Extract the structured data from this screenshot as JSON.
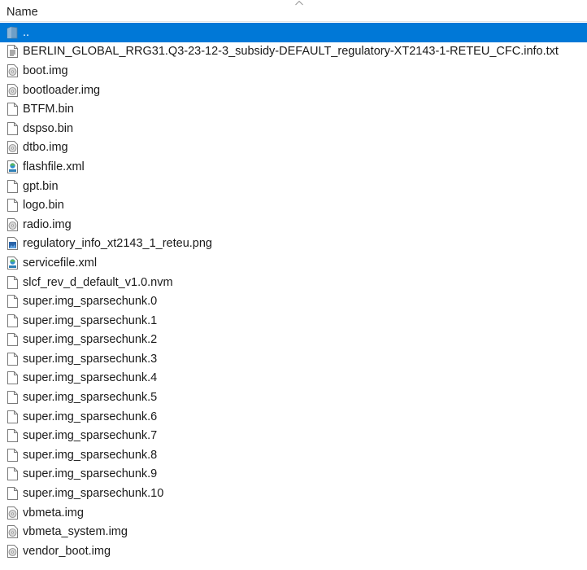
{
  "header": {
    "column_name": "Name",
    "sort_icon": "chevron-up-icon"
  },
  "files": [
    {
      "name": "..",
      "icon": "parent-folder-icon",
      "selected": true
    },
    {
      "name": "BERLIN_GLOBAL_RRG31.Q3-23-12-3_subsidy-DEFAULT_regulatory-XT2143-1-RETEU_CFC.info.txt",
      "icon": "text-file-icon"
    },
    {
      "name": "boot.img",
      "icon": "disc-image-icon"
    },
    {
      "name": "bootloader.img",
      "icon": "disc-image-icon"
    },
    {
      "name": "BTFM.bin",
      "icon": "blank-file-icon"
    },
    {
      "name": "dspso.bin",
      "icon": "blank-file-icon"
    },
    {
      "name": "dtbo.img",
      "icon": "disc-image-icon"
    },
    {
      "name": "flashfile.xml",
      "icon": "xml-file-icon"
    },
    {
      "name": "gpt.bin",
      "icon": "blank-file-icon"
    },
    {
      "name": "logo.bin",
      "icon": "blank-file-icon"
    },
    {
      "name": "radio.img",
      "icon": "disc-image-icon"
    },
    {
      "name": "regulatory_info_xt2143_1_reteu.png",
      "icon": "image-file-icon"
    },
    {
      "name": "servicefile.xml",
      "icon": "xml-file-icon"
    },
    {
      "name": "slcf_rev_d_default_v1.0.nvm",
      "icon": "blank-file-icon"
    },
    {
      "name": "super.img_sparsechunk.0",
      "icon": "blank-file-icon"
    },
    {
      "name": "super.img_sparsechunk.1",
      "icon": "blank-file-icon"
    },
    {
      "name": "super.img_sparsechunk.2",
      "icon": "blank-file-icon"
    },
    {
      "name": "super.img_sparsechunk.3",
      "icon": "blank-file-icon"
    },
    {
      "name": "super.img_sparsechunk.4",
      "icon": "blank-file-icon"
    },
    {
      "name": "super.img_sparsechunk.5",
      "icon": "blank-file-icon"
    },
    {
      "name": "super.img_sparsechunk.6",
      "icon": "blank-file-icon"
    },
    {
      "name": "super.img_sparsechunk.7",
      "icon": "blank-file-icon"
    },
    {
      "name": "super.img_sparsechunk.8",
      "icon": "blank-file-icon"
    },
    {
      "name": "super.img_sparsechunk.9",
      "icon": "blank-file-icon"
    },
    {
      "name": "super.img_sparsechunk.10",
      "icon": "blank-file-icon"
    },
    {
      "name": "vbmeta.img",
      "icon": "disc-image-icon"
    },
    {
      "name": "vbmeta_system.img",
      "icon": "disc-image-icon"
    },
    {
      "name": "vendor_boot.img",
      "icon": "disc-image-icon"
    }
  ],
  "colors": {
    "selection": "#0078d7",
    "header_border": "#e5e5e5"
  }
}
